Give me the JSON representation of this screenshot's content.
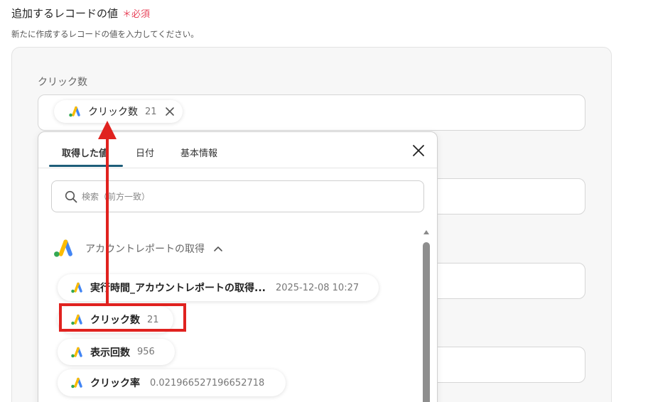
{
  "section": {
    "title": "追加するレコードの値",
    "required": "＊必須",
    "description": "新たに作成するレコードの値を入力してください。"
  },
  "field": {
    "label": "クリック数",
    "selected": {
      "label": "クリック数",
      "value": "21",
      "icon": "google-ads-icon"
    }
  },
  "popup": {
    "tabs": [
      "取得した値",
      "日付",
      "基本情報"
    ],
    "active_tab": "取得した値",
    "search_placeholder": "検索（前方一致）",
    "group": {
      "label": "アカウントレポートの取得",
      "expanded": true,
      "icon": "google-ads-icon"
    },
    "items": [
      {
        "label": "実行時間_アカウントレポートの取得...",
        "value": "2025-12-08 10:27"
      },
      {
        "label": "クリック数",
        "value": "21"
      },
      {
        "label": "表示回数",
        "value": "956"
      },
      {
        "label": "クリック率",
        "value": "0.021966527196652718"
      }
    ]
  },
  "colors": {
    "accent": "#1e5d79",
    "required": "#e8455b",
    "annotation": "#e0221f",
    "ads_blue": "#4285f4",
    "ads_yellow": "#fbbc04",
    "ads_green": "#34a853"
  }
}
